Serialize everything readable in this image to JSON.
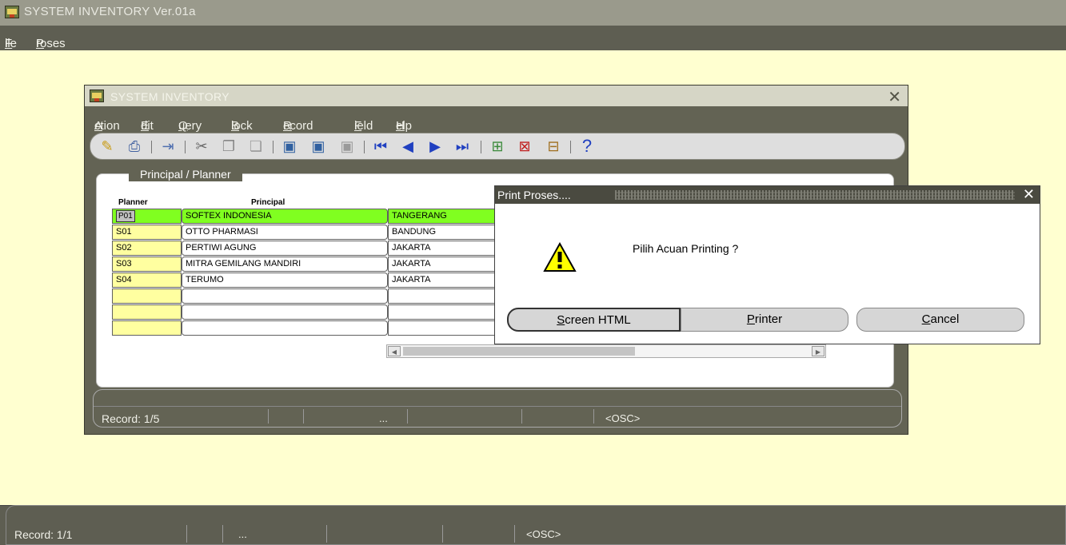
{
  "app": {
    "title": "SYSTEM INVENTORY  Ver.01a"
  },
  "menubar": {
    "items": [
      {
        "label": "File",
        "mn": "F",
        "rest": "ile"
      },
      {
        "label": "Proses",
        "mn": "P",
        "rest": "roses"
      }
    ]
  },
  "window": {
    "title": "SYSTEM INVENTORY",
    "menu": [
      {
        "mn": "A",
        "rest": "ction"
      },
      {
        "mn": "E",
        "rest": "dit"
      },
      {
        "mn": "Q",
        "rest": "uery"
      },
      {
        "mn": "B",
        "rest": "lock"
      },
      {
        "mn": "R",
        "rest": "ecord"
      },
      {
        "mn": "F",
        "rest": "ield"
      },
      {
        "mn": "H",
        "rest": "elp"
      }
    ],
    "toolbar_icons": [
      "save-icon",
      "print-icon",
      "exit-icon",
      "cut-icon",
      "copy-icon",
      "paste-icon",
      "enter-query-icon",
      "execute-query-icon",
      "cancel-query-icon",
      "first-record-icon",
      "previous-record-icon",
      "next-record-icon",
      "last-record-icon",
      "insert-record-icon",
      "delete-record-icon",
      "lock-record-icon",
      "help-icon"
    ],
    "help_glyph": "?",
    "panel_title": "Principal / Planner",
    "columns": {
      "planner": "Planner",
      "principal": "Principal"
    },
    "rows": [
      {
        "planner": "P01",
        "principal": "SOFTEX INDONESIA",
        "city": "TANGERANG"
      },
      {
        "planner": "S01",
        "principal": "OTTO PHARMASI",
        "city": "BANDUNG"
      },
      {
        "planner": "S02",
        "principal": "PERTIWI AGUNG",
        "city": "JAKARTA"
      },
      {
        "planner": "S03",
        "principal": "MITRA GEMILANG MANDIRI",
        "city": "JAKARTA"
      },
      {
        "planner": "S04",
        "principal": "TERUMO",
        "city": "JAKARTA"
      }
    ],
    "status": {
      "record": "Record: 1/5",
      "dots": "...",
      "osc": "<OSC>"
    }
  },
  "bottom_status": {
    "record": "Record: 1/1",
    "dots": "...",
    "osc": "<OSC>"
  },
  "dialog": {
    "title": "Print Proses....",
    "message": "Pilih Acuan Printing ?",
    "buttons": {
      "screen": {
        "mn": "S",
        "rest": "creen HTML"
      },
      "printer": {
        "mn": "P",
        "rest": "rinter"
      },
      "cancel": {
        "mn": "C",
        "rest": "ancel"
      }
    }
  },
  "colors": {
    "selected_row": "#80ff20",
    "planner_cell": "#ffffa0",
    "desktop": "#ffffd0",
    "frame": "#5e5e52"
  }
}
